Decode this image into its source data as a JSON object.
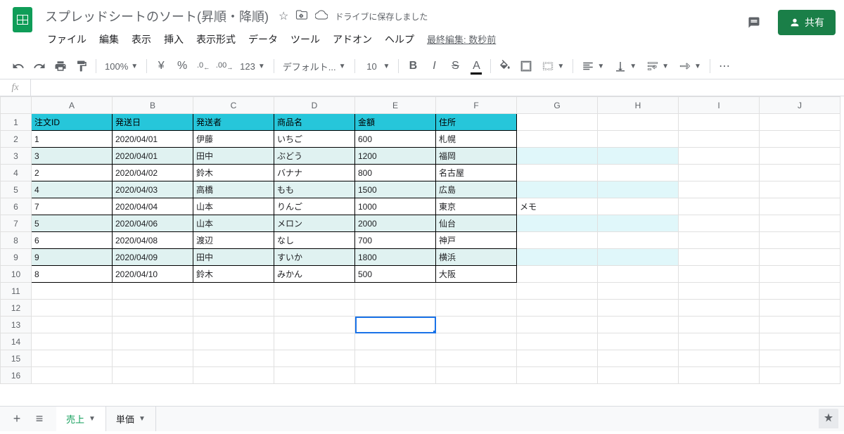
{
  "doc": {
    "title": "スプレッドシートのソート(昇順・降順)",
    "save_status": "ドライブに保存しました",
    "last_edit": "最終編集: 数秒前"
  },
  "menu": [
    "ファイル",
    "編集",
    "表示",
    "挿入",
    "表示形式",
    "データ",
    "ツール",
    "アドオン",
    "ヘルプ"
  ],
  "toolbar": {
    "zoom": "100%",
    "currency": "¥",
    "percent": "%",
    "dec_dec": ".0",
    "dec_inc": ".00",
    "format_more": "123",
    "font": "デフォルト...",
    "size": "10"
  },
  "share": "共有",
  "columns": [
    "A",
    "B",
    "C",
    "D",
    "E",
    "F",
    "G",
    "H",
    "I",
    "J"
  ],
  "row_count": 16,
  "headers": [
    "注文ID",
    "発送日",
    "発送者",
    "商品名",
    "金額",
    "住所"
  ],
  "rows": [
    {
      "id": "1",
      "date": "2020/04/01",
      "sender": "伊藤",
      "product": "いちご",
      "amount": "600",
      "address": "札幌",
      "memo": ""
    },
    {
      "id": "3",
      "date": "2020/04/01",
      "sender": "田中",
      "product": "ぶどう",
      "amount": "1200",
      "address": "福岡",
      "memo": ""
    },
    {
      "id": "2",
      "date": "2020/04/02",
      "sender": "鈴木",
      "product": "バナナ",
      "amount": "800",
      "address": "名古屋",
      "memo": ""
    },
    {
      "id": "4",
      "date": "2020/04/03",
      "sender": "高橋",
      "product": "もも",
      "amount": "1500",
      "address": "広島",
      "memo": ""
    },
    {
      "id": "7",
      "date": "2020/04/04",
      "sender": "山本",
      "product": "りんご",
      "amount": "1000",
      "address": "東京",
      "memo": "メモ"
    },
    {
      "id": "5",
      "date": "2020/04/06",
      "sender": "山本",
      "product": "メロン",
      "amount": "2000",
      "address": "仙台",
      "memo": ""
    },
    {
      "id": "6",
      "date": "2020/04/08",
      "sender": "渡辺",
      "product": "なし",
      "amount": "700",
      "address": "神戸",
      "memo": ""
    },
    {
      "id": "9",
      "date": "2020/04/09",
      "sender": "田中",
      "product": "すいか",
      "amount": "1800",
      "address": "横浜",
      "memo": ""
    },
    {
      "id": "8",
      "date": "2020/04/10",
      "sender": "鈴木",
      "product": "みかん",
      "amount": "500",
      "address": "大阪",
      "memo": ""
    }
  ],
  "selected_cell": {
    "row": 13,
    "col": "E"
  },
  "sheets": {
    "active": "売上",
    "others": [
      "単価"
    ]
  }
}
